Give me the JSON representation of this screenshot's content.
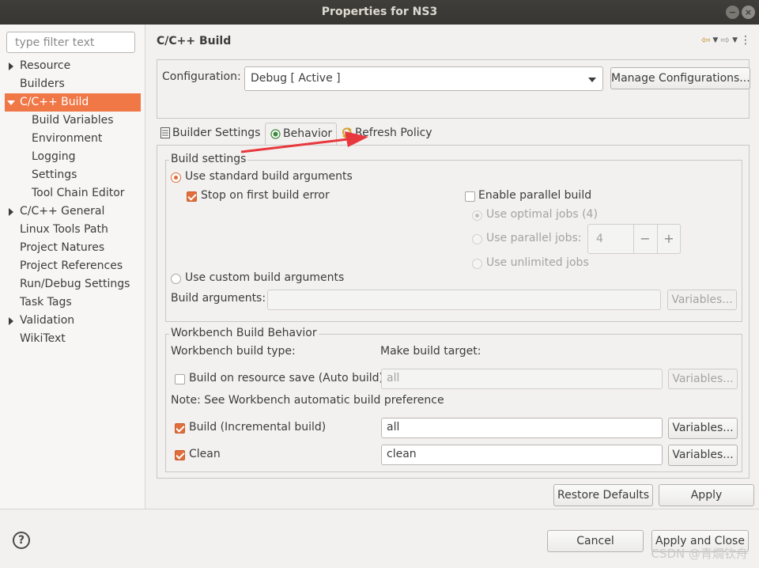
{
  "window": {
    "title": "Properties for NS3",
    "min_glyph": "−",
    "close_glyph": "×"
  },
  "sidebar": {
    "filter_placeholder": "type filter text",
    "items": [
      {
        "label": "Resource",
        "level": 0,
        "expander": "collapsed"
      },
      {
        "label": "Builders",
        "level": 0
      },
      {
        "label": "C/C++ Build",
        "level": 0,
        "expander": "expanded",
        "selected": true
      },
      {
        "label": "Build Variables",
        "level": 1
      },
      {
        "label": "Environment",
        "level": 1
      },
      {
        "label": "Logging",
        "level": 1
      },
      {
        "label": "Settings",
        "level": 1
      },
      {
        "label": "Tool Chain Editor",
        "level": 1
      },
      {
        "label": "C/C++ General",
        "level": 0,
        "expander": "collapsed"
      },
      {
        "label": "Linux Tools Path",
        "level": 0
      },
      {
        "label": "Project Natures",
        "level": 0
      },
      {
        "label": "Project References",
        "level": 0
      },
      {
        "label": "Run/Debug Settings",
        "level": 0
      },
      {
        "label": "Task Tags",
        "level": 0
      },
      {
        "label": "Validation",
        "level": 0,
        "expander": "collapsed"
      },
      {
        "label": "WikiText",
        "level": 0
      }
    ]
  },
  "main": {
    "title": "C/C++ Build",
    "nav_icons": [
      "back-arrow-icon",
      "dropdown-icon",
      "forward-arrow-icon",
      "dropdown-icon",
      "view-menu-icon"
    ],
    "configuration_label": "Configuration:",
    "configuration_value": "Debug  [ Active ]",
    "manage_button": "Manage Configurations...",
    "tabs": [
      {
        "label": "Builder Settings",
        "icon": "builder-settings-icon"
      },
      {
        "label": "Behavior",
        "icon": "behavior-icon",
        "active": true
      },
      {
        "label": "Refresh Policy",
        "icon": "refresh-icon"
      }
    ],
    "build_settings": {
      "title": "Build settings",
      "use_standard": "Use standard build arguments",
      "stop_on_error": "Stop on first build error",
      "enable_parallel": "Enable parallel build",
      "use_optimal": "Use optimal jobs (4)",
      "use_parallel": "Use parallel jobs:",
      "parallel_jobs_value": "4",
      "minus": "−",
      "plus": "+",
      "use_unlimited": "Use unlimited jobs",
      "use_custom": "Use custom build arguments",
      "build_arguments_label": "Build arguments:",
      "variables_button": "Variables..."
    },
    "workbench": {
      "title": "Workbench Build Behavior",
      "build_type_label": "Workbench build type:",
      "make_target_label": "Make build target:",
      "auto_build_label": "Build on resource save (Auto build)",
      "auto_build_value": "all",
      "note": "Note: See Workbench automatic build preference",
      "incremental_label": "Build (Incremental build)",
      "incremental_value": "all",
      "clean_label": "Clean",
      "clean_value": "clean",
      "variables_button": "Variables..."
    },
    "restore_defaults": "Restore Defaults",
    "apply": "Apply"
  },
  "footer": {
    "help_glyph": "?",
    "cancel": "Cancel",
    "apply_and_close": "Apply and Close",
    "watermark": "CSDN @青燗钦舟"
  },
  "colors": {
    "accent": "#f07746",
    "annotation_arrow": "#e8383d"
  }
}
